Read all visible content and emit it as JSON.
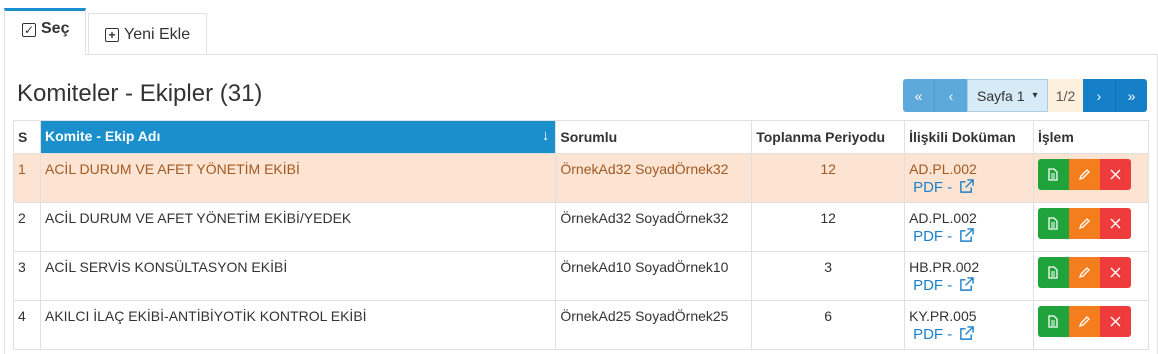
{
  "tabs": [
    {
      "label": "Seç",
      "icon": "checkbox-icon"
    },
    {
      "label": "Yeni Ekle",
      "icon": "plus-box-icon"
    }
  ],
  "title": "Komiteler - Ekipler (31)",
  "pager": {
    "page_label": "Sayfa 1",
    "count": "1/2"
  },
  "columns": [
    "S",
    "Komite - Ekip Adı",
    "Sorumlu",
    "Toplanma Periyodu",
    "İlişkili Doküman",
    "İşlem"
  ],
  "pdf_label": "PDF - ",
  "rows": [
    {
      "no": "1",
      "name": "ACİL DURUM VE AFET YÖNETİM EKİBİ",
      "owner": "ÖrnekAd32 SoyadÖrnek32",
      "period": "12",
      "doc": "AD.PL.002"
    },
    {
      "no": "2",
      "name": "ACİL DURUM VE AFET YÖNETİM EKİBİ/YEDEK",
      "owner": "ÖrnekAd32 SoyadÖrnek32",
      "period": "12",
      "doc": "AD.PL.002"
    },
    {
      "no": "3",
      "name": "ACİL SERVİS KONSÜLTASYON EKİBİ",
      "owner": "ÖrnekAd10 SoyadÖrnek10",
      "period": "3",
      "doc": "HB.PR.002"
    },
    {
      "no": "4",
      "name": "AKILCI İLAÇ EKİBİ-ANTİBİYOTİK KONTROL EKİBİ",
      "owner": "ÖrnekAd25 SoyadÖrnek25",
      "period": "6",
      "doc": "KY.PR.005"
    }
  ],
  "colors": {
    "accent": "#1a8fcb",
    "selected_row": "#fde3d1",
    "view_btn": "#1fa33a",
    "edit_btn": "#f47e1e",
    "delete_btn": "#ee3b3b"
  }
}
